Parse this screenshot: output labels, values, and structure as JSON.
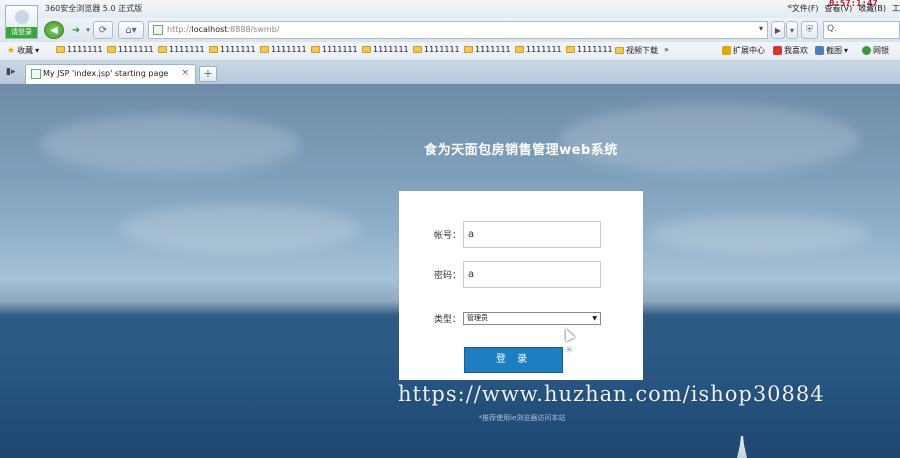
{
  "browser": {
    "app_title": "360安全浏览器 5.0 正式版",
    "menus": [
      "文件(F)",
      "查看(V)",
      "收藏(B)",
      "工"
    ],
    "clock": "0:57:1:47",
    "login_label": "请登录",
    "url_prefix": "http://",
    "url_host": "localhost",
    "url_rest": ":8888/swmb/",
    "search_placeholder": "Q."
  },
  "favorites": {
    "star_label": "收藏",
    "folders": [
      "1111111",
      "1111111",
      "1111111",
      "1111111",
      "1111111",
      "1111111",
      "1111111",
      "1111111",
      "1111111",
      "1111111",
      "1111111"
    ],
    "video": "视频下载",
    "more": "»",
    "extensions": [
      {
        "label": "扩展中心",
        "color": "#e0a800"
      },
      {
        "label": "我喜欢",
        "color": "#d9342b"
      },
      {
        "label": "截图",
        "color": "#4a7fbd"
      },
      {
        "label": "网银",
        "color": "#3a9a3a"
      }
    ]
  },
  "tab": {
    "title": "My JSP 'index.jsp' starting page",
    "close": "×",
    "new": "+"
  },
  "page": {
    "system_title": "食为天面包房销售管理web系统",
    "account_label": "帐号：",
    "account_value": "a",
    "password_label": "密码：",
    "password_value": "a",
    "type_label": "类型：",
    "type_value": "管理员",
    "login_button": "登 录",
    "note": "*推荐使用ie浏览器访问本站",
    "watermark": "https://www.huzhan.com/ishop30884"
  }
}
